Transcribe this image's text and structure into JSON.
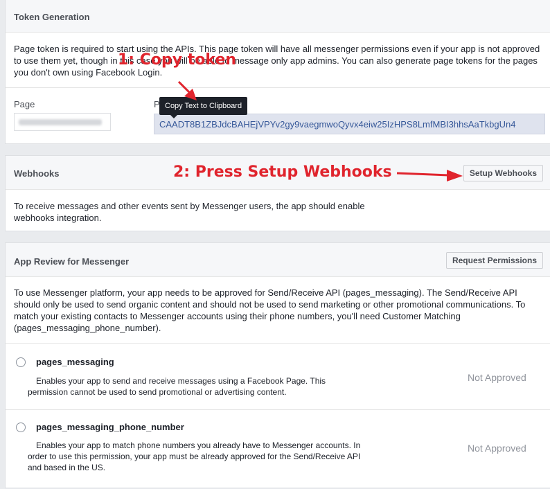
{
  "token_generation": {
    "title": "Token Generation",
    "description": "Page token is required to start using the APIs. This page token will have all messenger permissions even if your app is not approved to use them yet, though in this case you will be able to message only app admins. You can also generate page tokens for the pages you don't own using Facebook Login.",
    "page_label": "Page",
    "token_label": "Page Access Token",
    "token_value": "CAADT8B1ZBJdcBAHEjVPYv2gy9vaegmwoQyvx4eiw25IzHPS8LmfMBI3hhsAaTkbgUn4",
    "tooltip": "Copy Text to Clipboard"
  },
  "webhooks": {
    "title": "Webhooks",
    "button_label": "Setup Webhooks",
    "description": "To receive messages and other events sent by Messenger users, the app should enable webhooks integration."
  },
  "app_review": {
    "title": "App Review for Messenger",
    "button_label": "Request Permissions",
    "description": "To use Messenger platform, your app needs to be approved for Send/Receive API (pages_messaging). The Send/Receive API should only be used to send organic content and should not be used to send marketing or other promotional communications. To match your existing contacts to Messenger accounts using their phone numbers, you'll need Customer Matching (pages_messaging_phone_number).",
    "permissions": [
      {
        "name": "pages_messaging",
        "description": "Enables your app to send and receive messages using a Facebook Page. This permission cannot be used to send promotional or advertising content.",
        "status": "Not Approved"
      },
      {
        "name": "pages_messaging_phone_number",
        "description": "Enables your app to match phone numbers you already have to Messenger accounts. In order to use this permission, your app must be already approved for the Send/Receive API and based in the US.",
        "status": "Not Approved"
      }
    ]
  },
  "annotations": {
    "step1": "1: Copy token",
    "step2": "2: Press Setup Webhooks",
    "color": "#e0242d"
  }
}
